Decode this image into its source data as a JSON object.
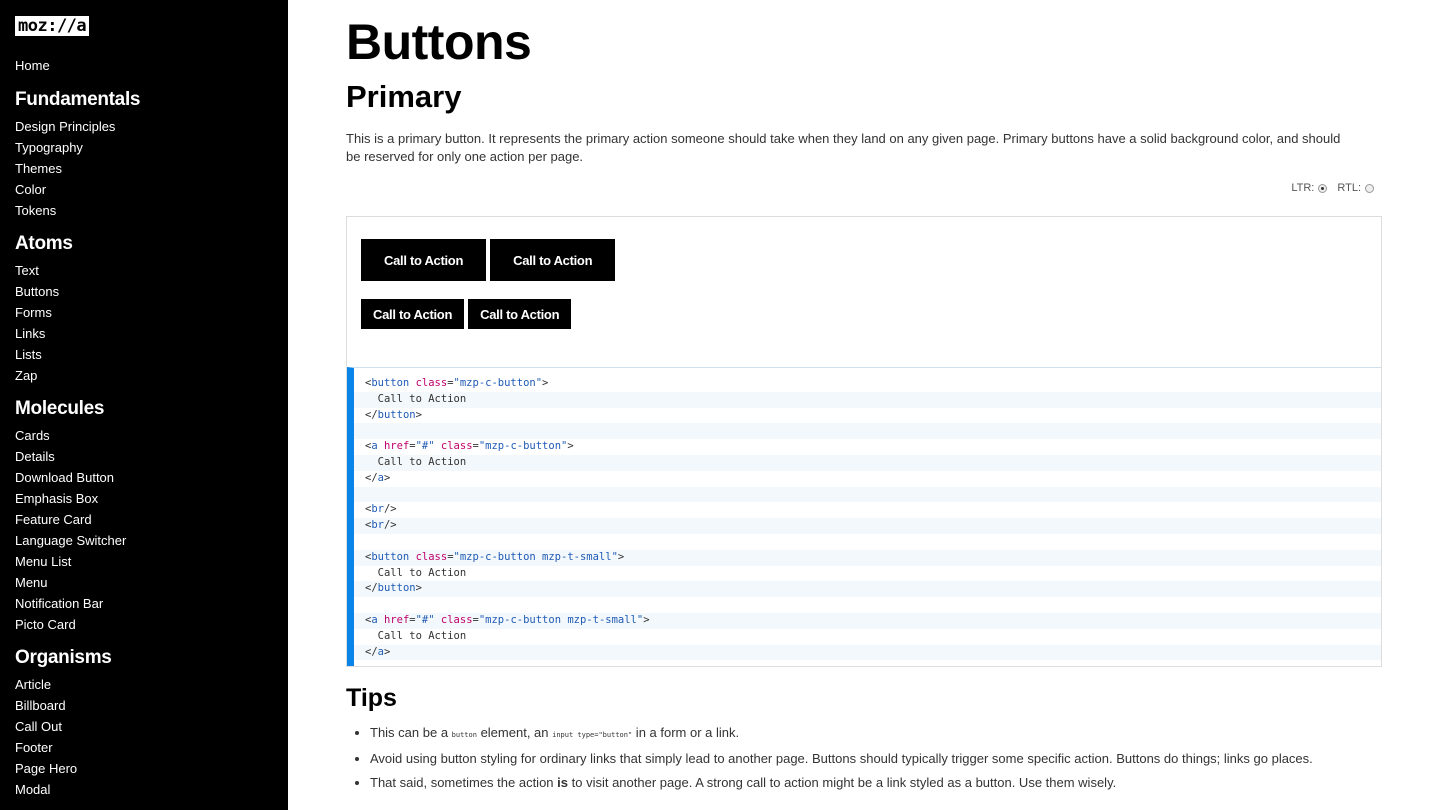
{
  "sidebar": {
    "logo": "moz://a",
    "home": "Home",
    "sections": [
      {
        "title": "Fundamentals",
        "items": [
          "Design Principles",
          "Typography",
          "Themes",
          "Color",
          "Tokens"
        ]
      },
      {
        "title": "Atoms",
        "items": [
          "Text",
          "Buttons",
          "Forms",
          "Links",
          "Lists",
          "Zap"
        ]
      },
      {
        "title": "Molecules",
        "items": [
          "Cards",
          "Details",
          "Download Button",
          "Emphasis Box",
          "Feature Card",
          "Language Switcher",
          "Menu List",
          "Menu",
          "Notification Bar",
          "Picto Card"
        ]
      },
      {
        "title": "Organisms",
        "items": [
          "Article",
          "Billboard",
          "Call Out",
          "Footer",
          "Page Hero",
          "Modal"
        ]
      }
    ]
  },
  "main": {
    "title": "Buttons",
    "subtitle": "Primary",
    "description": "This is a primary button. It represents the primary action someone should take when they land on any given page. Primary buttons have a solid background color, and should be reserved for only one action per page.",
    "ltr_label": "LTR:",
    "rtl_label": "RTL:",
    "button_label": "Call to Action",
    "code_text": {
      "button_tag": "button",
      "a_tag": "a",
      "br_tag": "br",
      "class_attr": "class",
      "href_attr": "href",
      "class_value": "\"mzp-c-button\"",
      "class_value_small": "\"mzp-c-button mzp-t-small\"",
      "href_value": "\"#\"",
      "inner_text": "Call to Action"
    },
    "tips_title": "Tips",
    "tips": {
      "t1_a": "This can be a ",
      "t1_code1": "button",
      "t1_b": " element, an ",
      "t1_code2": "input type=\"button\"",
      "t1_c": " in a form or a link.",
      "t2": "Avoid using button styling for ordinary links that simply lead to another page. Buttons should typically trigger some specific action. Buttons do things; links go places.",
      "t3_a": "That said, sometimes the action ",
      "t3_bold": "is",
      "t3_b": " to visit another page. A strong call to action might be a link styled as a button. Use them wisely."
    }
  },
  "colors": {
    "sidebar_bg": "#000000",
    "code_accent": "#0a84e9",
    "code_tag": "#1f5bb5",
    "code_attr": "#c0006a"
  }
}
